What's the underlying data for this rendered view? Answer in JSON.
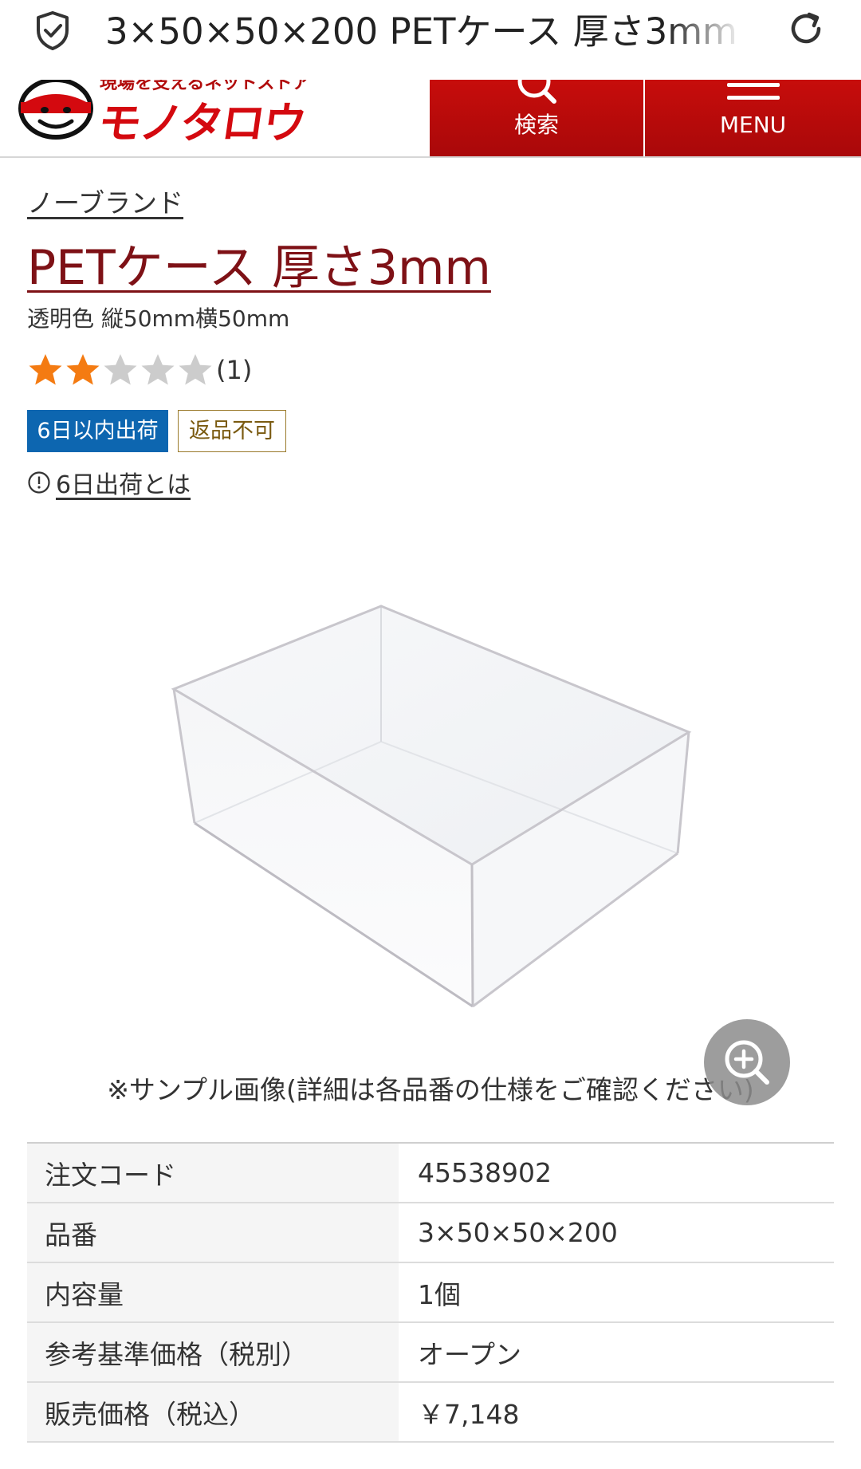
{
  "browser": {
    "tab_title": "3×50×50×200 PETケース 厚さ3mm",
    "security_icon": "shield-check-icon",
    "reload_icon": "reload-icon"
  },
  "header": {
    "logo_tagline": "現場を支えるネットストア",
    "logo_text": "モノタロウ",
    "search_label": "検索",
    "menu_label": "MENU",
    "accent_color": "#c70d0b"
  },
  "product": {
    "brand": "ノーブランド",
    "title": "PETケース 厚さ3mm",
    "subtitle": "透明色 縦50mm横50mm",
    "rating": 2,
    "rating_max": 5,
    "review_count": "(1)",
    "badge_shipping": "6日以内出荷",
    "badge_no_return": "返品不可",
    "shipping_info_link": "6日出荷とは",
    "image_caption": "※サンプル画像(詳細は各品番の仕様をご確認ください)"
  },
  "specs": [
    {
      "label": "注文コード",
      "value": "45538902"
    },
    {
      "label": "品番",
      "value": "3×50×50×200"
    },
    {
      "label": "内容量",
      "value": "1個"
    },
    {
      "label": "参考基準価格（税別）",
      "value": "オープン"
    },
    {
      "label": "販売価格（税込）",
      "value": "￥7,148"
    }
  ]
}
